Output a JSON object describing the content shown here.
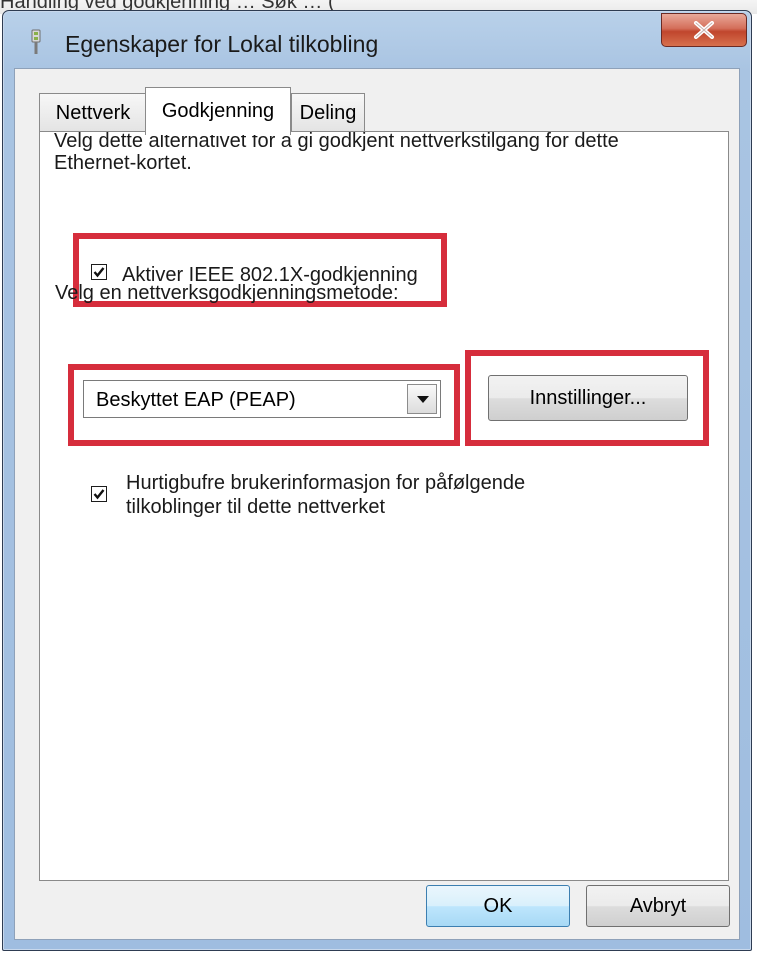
{
  "background_fragment": "Handling ved godkjenning  …  Søk  …  (",
  "window": {
    "title": "Egenskaper for Lokal tilkobling",
    "close_icon": "close-x-icon",
    "title_icon": "network-plug-icon"
  },
  "tabs": [
    {
      "label": "Nettverk",
      "active": false
    },
    {
      "label": "Godkjenning",
      "active": true
    },
    {
      "label": "Deling",
      "active": false
    }
  ],
  "auth": {
    "description": "Velg dette alternativet for å gi godkjent nettverkstilgang for dette Ethernet-kortet.",
    "enable_label": "Aktiver IEEE 802.1X-godkjenning",
    "enable_checked": true,
    "method_label": "Velg en nettverksgodkjenningsmetode:",
    "method_value": "Beskyttet EAP (PEAP)",
    "settings_button": "Innstillinger...",
    "cache_label_line1": "Hurtigbufre brukerinformasjon for påfølgende",
    "cache_label_line2": "tilkoblinger til dette nettverket",
    "cache_checked": true
  },
  "buttons": {
    "ok": "OK",
    "cancel": "Avbryt"
  },
  "colors": {
    "highlight_box": "#d62d3c",
    "window_frame": "#a9c4e2",
    "dialog_bg": "#f0f0f0"
  }
}
